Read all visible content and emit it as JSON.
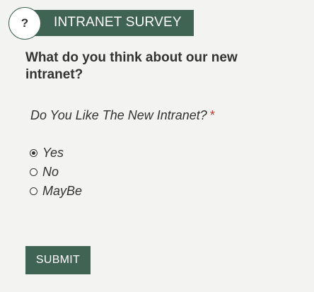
{
  "header": {
    "help_symbol": "?",
    "title": "INTRANET SURVEY"
  },
  "survey": {
    "heading": "What do you think about our new intranet?",
    "question": "Do You Like The New Intranet?",
    "required_marker": "*",
    "options": [
      {
        "label": "Yes",
        "selected": true
      },
      {
        "label": "No",
        "selected": false
      },
      {
        "label": "MayBe",
        "selected": false
      }
    ],
    "submit_label": "SUBMIT"
  },
  "colors": {
    "accent": "#3f6454",
    "background": "#f3f3f1",
    "required": "#c0392b"
  }
}
